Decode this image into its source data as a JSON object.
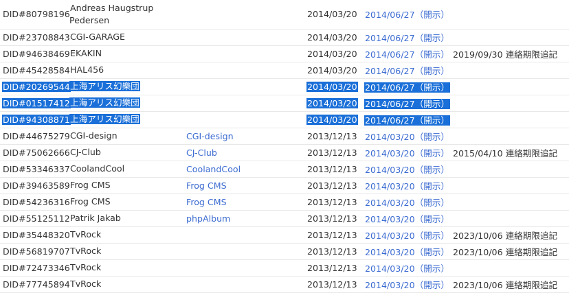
{
  "rows": [
    {
      "id": "DID#80798196",
      "name": "Andreas Haugstrup Pedersen",
      "link": "",
      "date1": "2014/03/20",
      "date2": "2014/06/27",
      "disclose": "（開示）",
      "extra": ""
    },
    {
      "id": "DID#23708843",
      "name": "CGI-GARAGE",
      "link": "",
      "date1": "2014/03/20",
      "date2": "2014/06/27",
      "disclose": "（開示）",
      "extra": ""
    },
    {
      "id": "DID#94638469",
      "name": "EKAKIN",
      "link": "",
      "date1": "2014/03/20",
      "date2": "2014/06/27",
      "disclose": "（開示）",
      "extra": "2019/09/30 連絡期限追記"
    },
    {
      "id": "DID#45428584",
      "name": "HAL456",
      "link": "",
      "date1": "2014/03/20",
      "date2": "2014/06/27",
      "disclose": "（開示）",
      "extra": ""
    },
    {
      "id": "DID#20269544",
      "name": "上海アリス幻樂団",
      "link": "",
      "date1": "2014/03/20",
      "date2": "2014/06/27",
      "disclose": "（開示）",
      "extra": ""
    },
    {
      "id": "DID#01517412",
      "name": "上海アリス幻樂団",
      "link": "",
      "date1": "2014/03/20",
      "date2": "2014/06/27",
      "disclose": "（開示）",
      "extra": ""
    },
    {
      "id": "DID#94308871",
      "name": "上海アリス幻樂団",
      "link": "",
      "date1": "2014/03/20",
      "date2": "2014/06/27",
      "disclose": "（開示）",
      "extra": ""
    },
    {
      "id": "DID#44675279",
      "name": "CGI-design",
      "link": "CGI-design",
      "date1": "2013/12/13",
      "date2": "2014/03/20",
      "disclose": "（開示）",
      "extra": ""
    },
    {
      "id": "DID#75062666",
      "name": "CJ-Club",
      "link": "CJ-Club",
      "date1": "2013/12/13",
      "date2": "2014/03/20",
      "disclose": "（開示）",
      "extra": "2015/04/10 連絡期限追記"
    },
    {
      "id": "DID#53346337",
      "name": "CoolandCool",
      "link": "CoolandCool",
      "date1": "2013/12/13",
      "date2": "2014/03/20",
      "disclose": "（開示）",
      "extra": ""
    },
    {
      "id": "DID#39463589",
      "name": "Frog CMS",
      "link": "Frog CMS",
      "date1": "2013/12/13",
      "date2": "2014/03/20",
      "disclose": "（開示）",
      "extra": ""
    },
    {
      "id": "DID#54236316",
      "name": "Frog CMS",
      "link": "Frog CMS",
      "date1": "2013/12/13",
      "date2": "2014/03/20",
      "disclose": "（開示）",
      "extra": ""
    },
    {
      "id": "DID#55125112",
      "name": "Patrik Jakab",
      "link": "phpAlbum",
      "date1": "2013/12/13",
      "date2": "2014/03/20",
      "disclose": "（開示）",
      "extra": ""
    },
    {
      "id": "DID#35448320",
      "name": "TvRock",
      "link": "",
      "date1": "2013/12/13",
      "date2": "2014/03/20",
      "disclose": "（開示）",
      "extra": "2023/10/06 連絡期限追記"
    },
    {
      "id": "DID#56819707",
      "name": "TvRock",
      "link": "",
      "date1": "2013/12/13",
      "date2": "2014/03/20",
      "disclose": "（開示）",
      "extra": "2023/10/06 連絡期限追記"
    },
    {
      "id": "DID#72473346",
      "name": "TvRock",
      "link": "",
      "date1": "2013/12/13",
      "date2": "2014/03/20",
      "disclose": "（開示）",
      "extra": ""
    },
    {
      "id": "DID#77745894",
      "name": "TvRock",
      "link": "",
      "date1": "2013/12/13",
      "date2": "2014/03/20",
      "disclose": "（開示）",
      "extra": "2023/10/06 連絡期限追記"
    }
  ],
  "selected_rows": [
    4,
    5,
    6
  ],
  "colors": {
    "link": "#3b6bd1",
    "selection": "#1a6fd8",
    "text": "#333333",
    "divider": "#e8e8e8"
  }
}
